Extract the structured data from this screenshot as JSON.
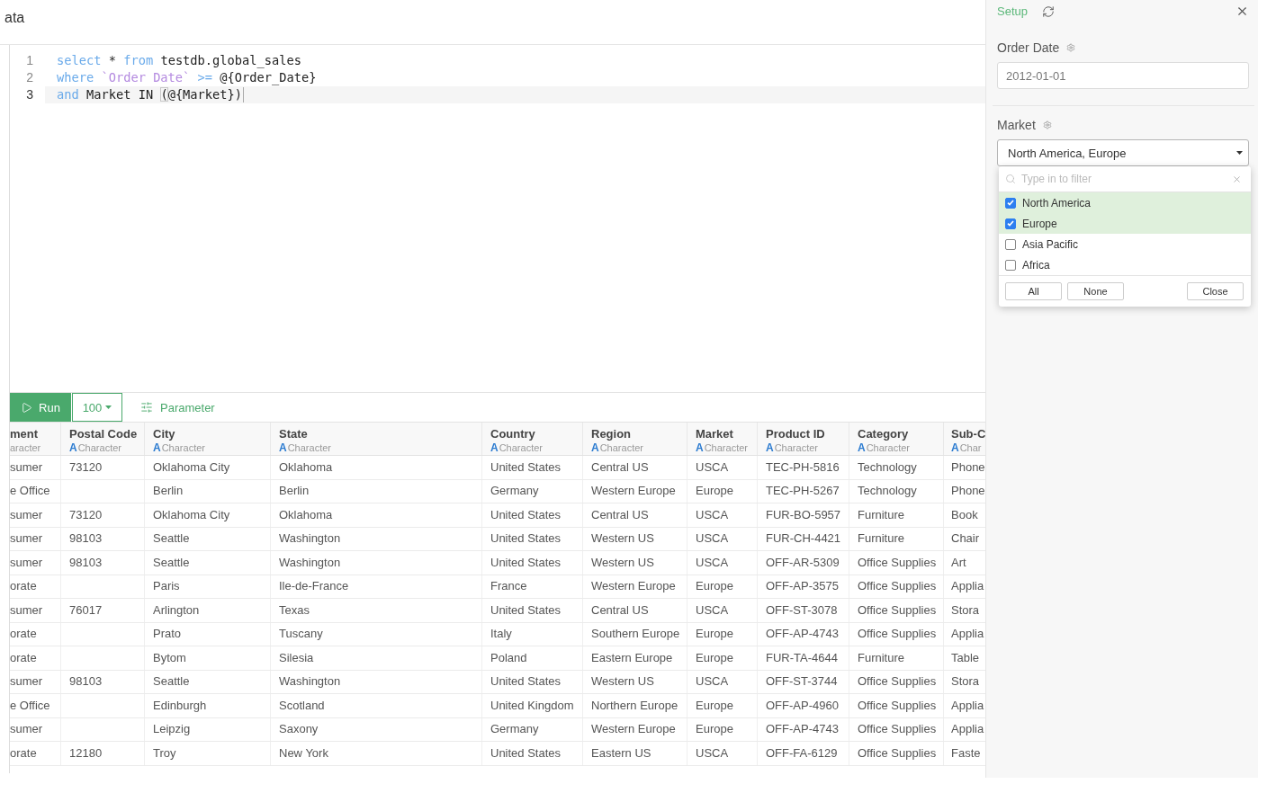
{
  "page": {
    "title": "ata"
  },
  "editor": {
    "lines": [
      {
        "number": "1",
        "current": false,
        "tokens": [
          {
            "kind": "keyword",
            "text": "select"
          },
          {
            "kind": "plain",
            "text": " * "
          },
          {
            "kind": "keyword",
            "text": "from"
          },
          {
            "kind": "plain",
            "text": " testdb.global_sales"
          }
        ]
      },
      {
        "number": "2",
        "current": false,
        "tokens": [
          {
            "kind": "keyword",
            "text": "where"
          },
          {
            "kind": "identifier",
            "text": " `Order Date`"
          },
          {
            "kind": "keyword",
            "text": " >="
          },
          {
            "kind": "plain",
            "text": " @{Order_Date}"
          }
        ]
      },
      {
        "number": "3",
        "current": true,
        "tokens": [
          {
            "kind": "keyword",
            "text": "and"
          },
          {
            "kind": "plain",
            "text": " Market IN "
          },
          {
            "kind": "bracket",
            "text": "("
          },
          {
            "kind": "plain",
            "text": "@{Market})"
          }
        ]
      }
    ]
  },
  "toolbar": {
    "run": "Run",
    "limit": "100",
    "parameter": "Parameter"
  },
  "table": {
    "columns": [
      {
        "name": "ment",
        "type": "aracter"
      },
      {
        "name": "Postal Code",
        "type_mark": "A",
        "type": "Character"
      },
      {
        "name": "City",
        "type_mark": "A",
        "type": "Character"
      },
      {
        "name": "State",
        "type_mark": "A",
        "type": "Character"
      },
      {
        "name": "Country",
        "type_mark": "A",
        "type": "Character"
      },
      {
        "name": "Region",
        "type_mark": "A",
        "type": "Character"
      },
      {
        "name": "Market",
        "type_mark": "A",
        "type": "Character"
      },
      {
        "name": "Product ID",
        "type_mark": "A",
        "type": "Character"
      },
      {
        "name": "Category",
        "type_mark": "A",
        "type": "Character"
      },
      {
        "name": "Sub-C",
        "type_mark": "A",
        "type": "Char"
      }
    ],
    "rows": [
      [
        "sumer",
        "73120",
        "Oklahoma City",
        "Oklahoma",
        "United States",
        "Central US",
        "USCA",
        "TEC-PH-5816",
        "Technology",
        "Phone"
      ],
      [
        "e Office",
        null,
        "Berlin",
        "Berlin",
        "Germany",
        "Western Europe",
        "Europe",
        "TEC-PH-5267",
        "Technology",
        "Phone"
      ],
      [
        "sumer",
        "73120",
        "Oklahoma City",
        "Oklahoma",
        "United States",
        "Central US",
        "USCA",
        "FUR-BO-5957",
        "Furniture",
        "Book"
      ],
      [
        "sumer",
        "98103",
        "Seattle",
        "Washington",
        "United States",
        "Western US",
        "USCA",
        "FUR-CH-4421",
        "Furniture",
        "Chair"
      ],
      [
        "sumer",
        "98103",
        "Seattle",
        "Washington",
        "United States",
        "Western US",
        "USCA",
        "OFF-AR-5309",
        "Office Supplies",
        "Art"
      ],
      [
        "orate",
        null,
        "Paris",
        "Ile-de-France",
        "France",
        "Western Europe",
        "Europe",
        "OFF-AP-3575",
        "Office Supplies",
        "Applia"
      ],
      [
        "sumer",
        "76017",
        "Arlington",
        "Texas",
        "United States",
        "Central US",
        "USCA",
        "OFF-ST-3078",
        "Office Supplies",
        "Stora"
      ],
      [
        "orate",
        null,
        "Prato",
        "Tuscany",
        "Italy",
        "Southern Europe",
        "Europe",
        "OFF-AP-4743",
        "Office Supplies",
        "Applia"
      ],
      [
        "orate",
        null,
        "Bytom",
        "Silesia",
        "Poland",
        "Eastern Europe",
        "Europe",
        "FUR-TA-4644",
        "Furniture",
        "Table"
      ],
      [
        "sumer",
        "98103",
        "Seattle",
        "Washington",
        "United States",
        "Western US",
        "USCA",
        "OFF-ST-3744",
        "Office Supplies",
        "Stora"
      ],
      [
        "e Office",
        null,
        "Edinburgh",
        "Scotland",
        "United Kingdom",
        "Northern Europe",
        "Europe",
        "OFF-AP-4960",
        "Office Supplies",
        "Applia"
      ],
      [
        "sumer",
        null,
        "Leipzig",
        "Saxony",
        "Germany",
        "Western Europe",
        "Europe",
        "OFF-AP-4743",
        "Office Supplies",
        "Applia"
      ],
      [
        "orate",
        "12180",
        "Troy",
        "New York",
        "United States",
        "Eastern US",
        "USCA",
        "OFF-FA-6129",
        "Office Supplies",
        "Faste"
      ]
    ]
  },
  "setup_panel": {
    "title": "Setup",
    "parameters": [
      {
        "kind": "date",
        "label": "Order Date",
        "value": "2012-01-01"
      },
      {
        "kind": "multiselect",
        "label": "Market",
        "value": "North America, Europe",
        "expanded": true,
        "filter_placeholder": "Type in to filter",
        "options": [
          {
            "label": "North America",
            "checked": true
          },
          {
            "label": "Europe",
            "checked": true
          },
          {
            "label": "Asia Pacific",
            "checked": false
          },
          {
            "label": "Africa",
            "checked": false
          }
        ],
        "buttons": [
          "All",
          "None",
          "Close"
        ]
      }
    ]
  }
}
